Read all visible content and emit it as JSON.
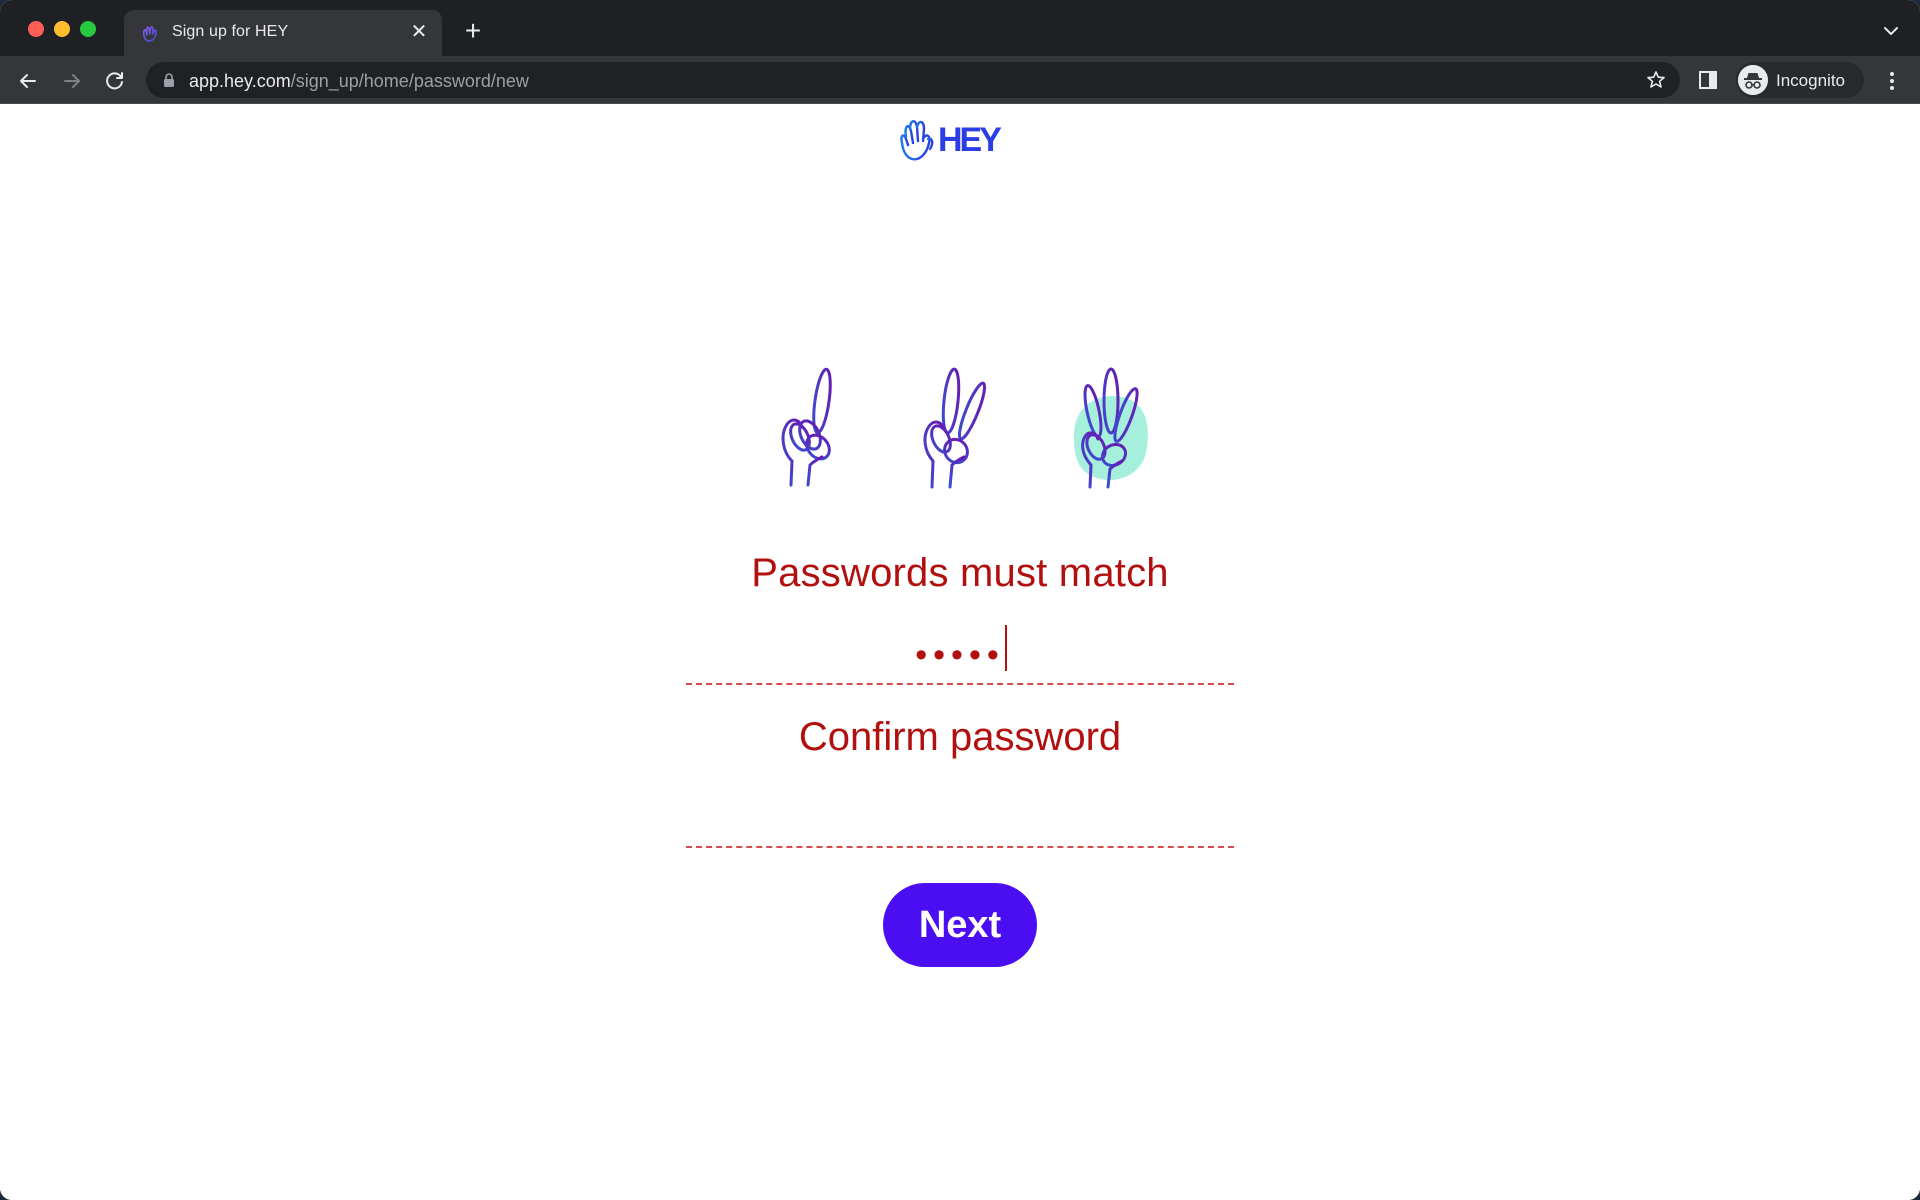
{
  "browser": {
    "tab": {
      "title": "Sign up for HEY",
      "favicon": "hey-hand-icon"
    },
    "url": {
      "host": "app.hey.com",
      "path": "/sign_up/home/password/new"
    },
    "profile_label": "Incognito",
    "icons": {
      "back": "arrow-left-icon",
      "forward": "arrow-right-icon",
      "reload": "reload-icon",
      "lock": "lock-icon",
      "bookmark": "star-icon",
      "side_panel": "side-panel-icon",
      "menu": "kebab-menu-icon",
      "tab_search": "chevron-down-icon",
      "new_tab": "plus-icon",
      "close_tab": "close-icon"
    }
  },
  "page": {
    "logo_text": "HEY",
    "steps": {
      "total": 3,
      "current": 3,
      "labels": [
        "step-one-hand",
        "step-two-hand",
        "step-three-hand"
      ]
    },
    "error_heading": "Passwords must match",
    "password_field": {
      "value": "•••••",
      "masked_length": 5
    },
    "confirm_field": {
      "label": "Confirm password",
      "value": ""
    },
    "next_button": "Next",
    "colors": {
      "error": "#b20f0f",
      "error_underline": "#d64b4b",
      "primary": "#4b0df2",
      "logo_blue": "#2b3ee6",
      "step_highlight": "#a6efdc",
      "hand_stroke_start": "#3a4fd0",
      "hand_stroke_end": "#6a18b0"
    }
  }
}
